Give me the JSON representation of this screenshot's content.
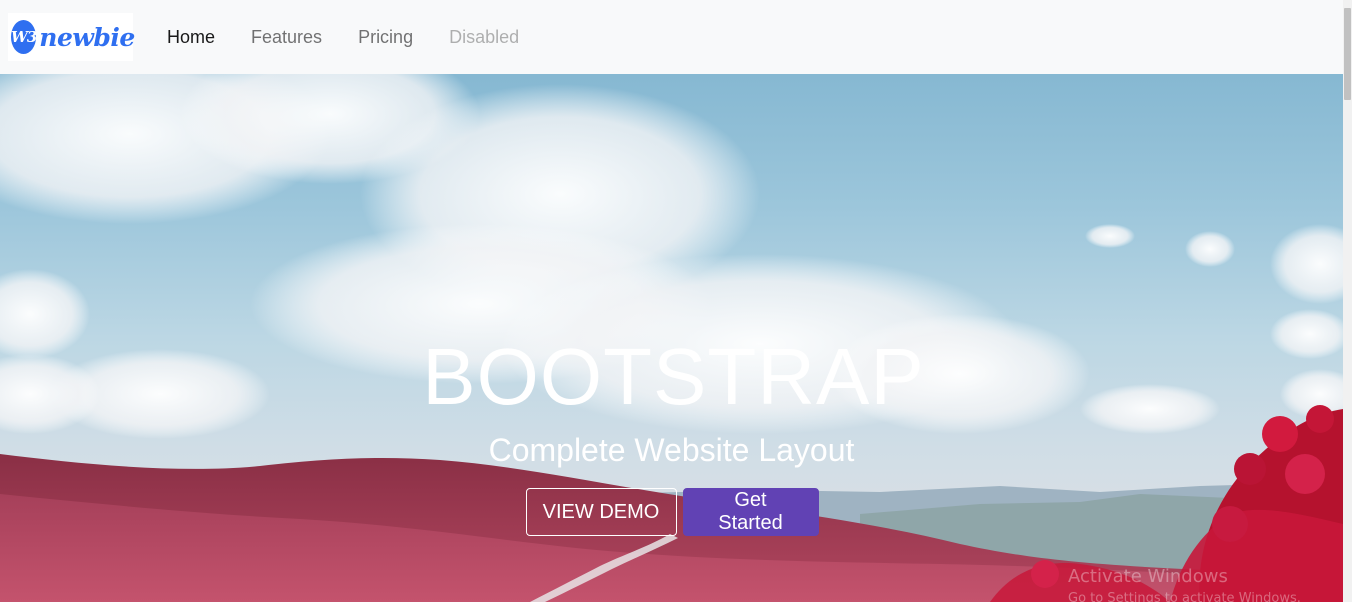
{
  "brand": {
    "badge": "W3",
    "name": "newbie"
  },
  "nav": {
    "items": [
      {
        "label": "Home"
      },
      {
        "label": "Features"
      },
      {
        "label": "Pricing"
      },
      {
        "label": "Disabled"
      }
    ]
  },
  "hero": {
    "title": "BOOTSTRAP",
    "subtitle": "Complete Website Layout",
    "demo_button": "VIEW DEMO",
    "cta_button": "Get Started"
  },
  "watermark": {
    "line1": "Activate Windows",
    "line2": "Go to Settings to activate Windows."
  },
  "colors": {
    "brand": "#2f6ff0",
    "primary_button": "#6142b4",
    "foliage": "#a33a55"
  }
}
